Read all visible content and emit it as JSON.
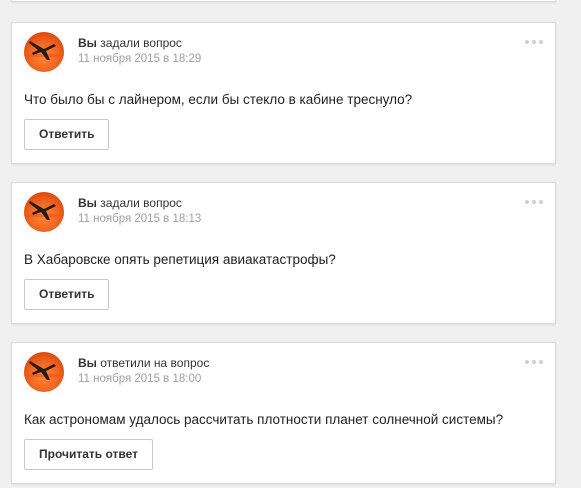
{
  "feed": [
    {
      "author": "Вы",
      "action": "задали вопрос",
      "date": "11 ноября 2015 в 18:29",
      "question": "Что было бы с лайнером, если бы стекло в кабине треснуло?",
      "button": "Ответить"
    },
    {
      "author": "Вы",
      "action": "задали вопрос",
      "date": "11 ноября 2015 в 18:13",
      "question": "В Хабаровске опять репетиция авиакатастрофы?",
      "button": "Ответить"
    },
    {
      "author": "Вы",
      "action": "ответили на вопрос",
      "date": "11 ноября 2015 в 18:00",
      "question": "Как астрономам удалось рассчитать плотности планет солнечной системы?",
      "button": "Прочитать ответ"
    }
  ],
  "colors": {
    "page_bg": "#f0f0f0",
    "card_bg": "#ffffff",
    "avatar_orange": "#f26522",
    "muted_text": "#a0a0a0"
  },
  "icons": [
    "avatar-airplane-sunset",
    "more-dots-icon"
  ]
}
